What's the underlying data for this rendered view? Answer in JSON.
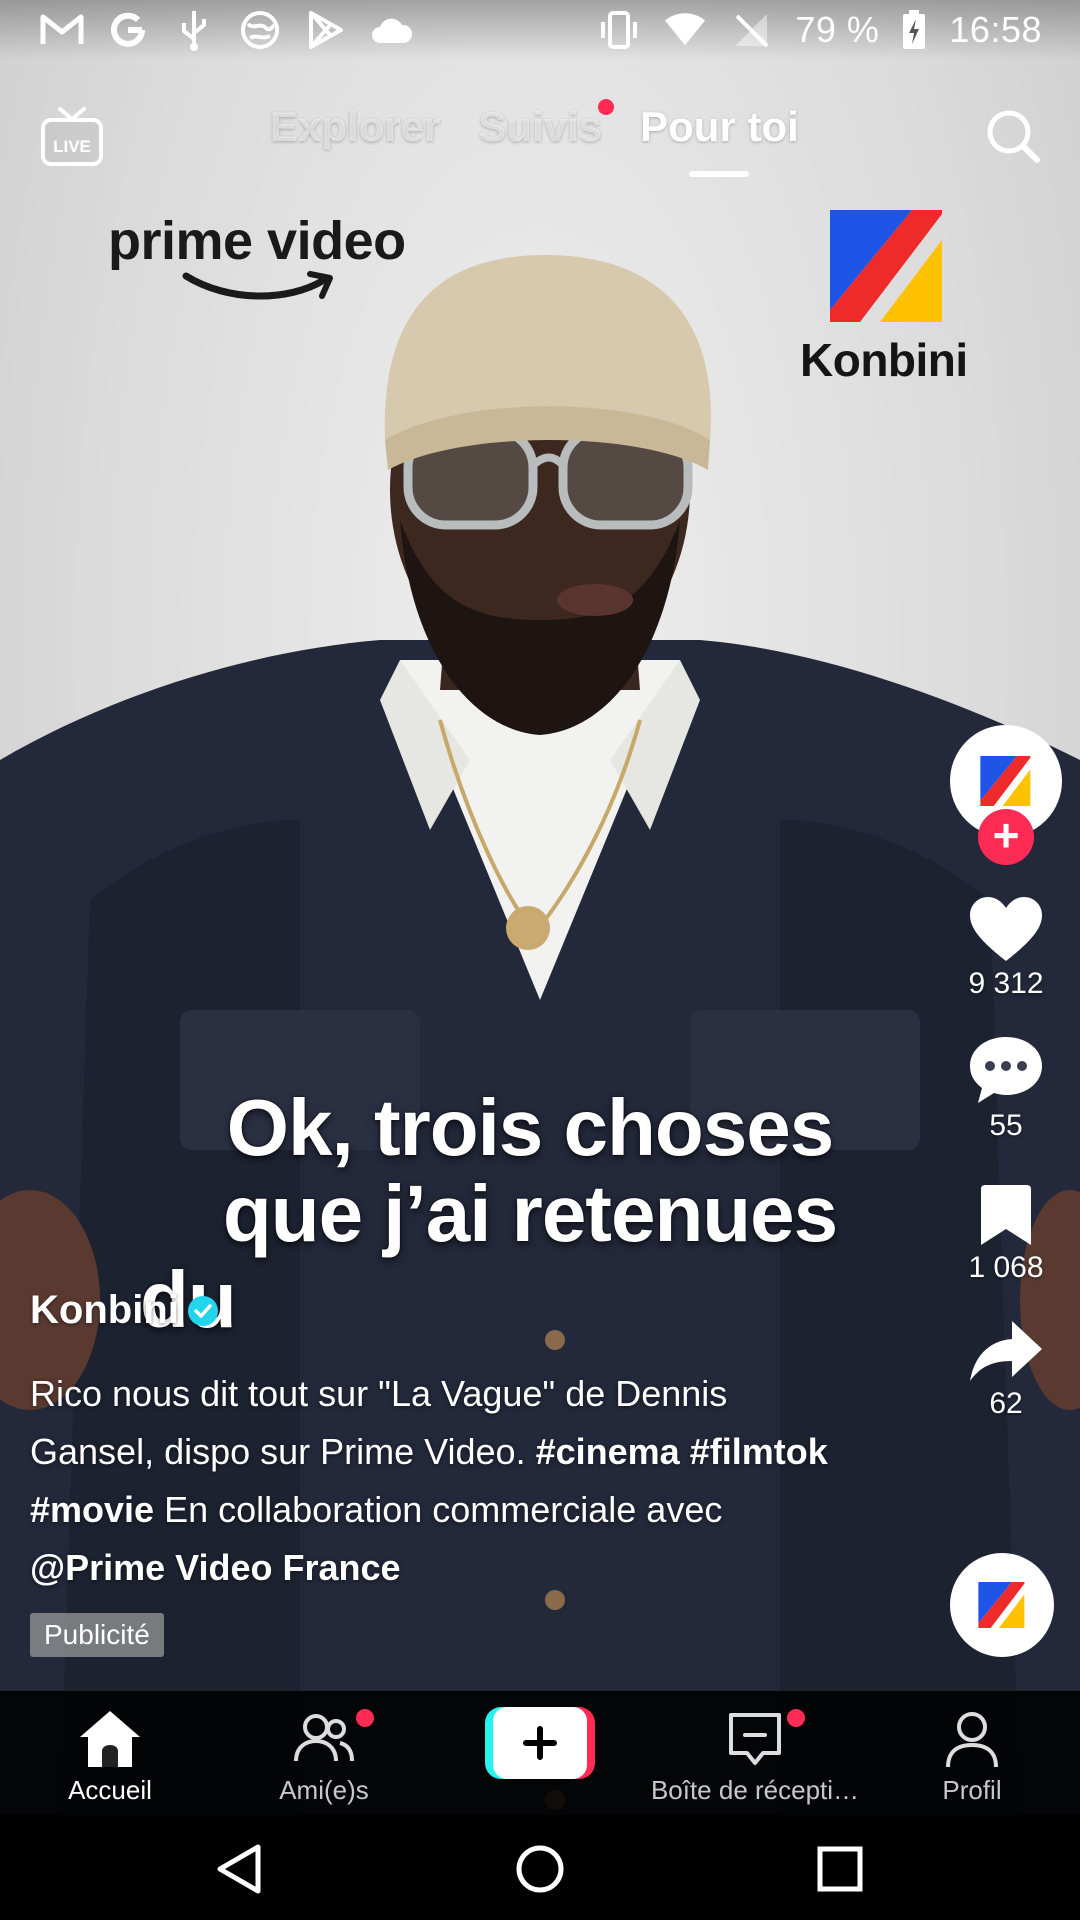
{
  "status_bar": {
    "battery": "79 %",
    "time": "16:58",
    "left_icons": [
      "gmail-icon",
      "google-icon",
      "usb-icon",
      "world-icon",
      "play-store-icon",
      "cloud-icon"
    ],
    "right_icons": [
      "vibrate-icon",
      "wifi-icon",
      "no-sim-icon",
      "battery-charging-icon"
    ]
  },
  "top_nav": {
    "live_label": "LIVE",
    "tabs": [
      {
        "label": "Explorer",
        "active": false
      },
      {
        "label": "Suivis",
        "active": false,
        "has_dot": true
      },
      {
        "label": "Pour toi",
        "active": true
      }
    ]
  },
  "video": {
    "brand_left": "prime video",
    "brand_right": "Konbini",
    "caption_lines": [
      "Ok, trois choses",
      "que j’ai retenues",
      "du"
    ]
  },
  "post": {
    "author": "Konbini",
    "verified": true,
    "description_parts": [
      {
        "text": "Rico nous dit tout sur \"La Vague\" de Dennis Gansel, dispo sur Prime Video. ",
        "bold": false
      },
      {
        "text": "#cinema",
        "bold": true
      },
      {
        "text": " ",
        "bold": false
      },
      {
        "text": "#filmtok",
        "bold": true
      },
      {
        "text": " ",
        "bold": false
      },
      {
        "text": "#movie",
        "bold": true
      },
      {
        "text": " En collaboration commerciale avec ",
        "bold": false
      },
      {
        "text": "@Prime Video France",
        "bold": true
      }
    ],
    "ad_label": "Publicité"
  },
  "actions": {
    "likes": "9 312",
    "comments": "55",
    "saves": "1 068",
    "shares": "62",
    "follow_symbol": "+"
  },
  "tabbar": {
    "items": [
      {
        "label": "Accueil",
        "active": true
      },
      {
        "label": "Ami(e)s",
        "active": false,
        "has_dot": true
      },
      {
        "label": "Boîte de récepti…",
        "active": false,
        "has_dot": true
      },
      {
        "label": "Profil",
        "active": false
      }
    ]
  },
  "colors": {
    "accent_red": "#fe2c55",
    "accent_cyan": "#25f4ee",
    "verified_blue": "#20d5ec",
    "konbini_blue": "#1e55e6",
    "konbini_red": "#ee2a2a",
    "konbini_yellow": "#ffc200"
  }
}
